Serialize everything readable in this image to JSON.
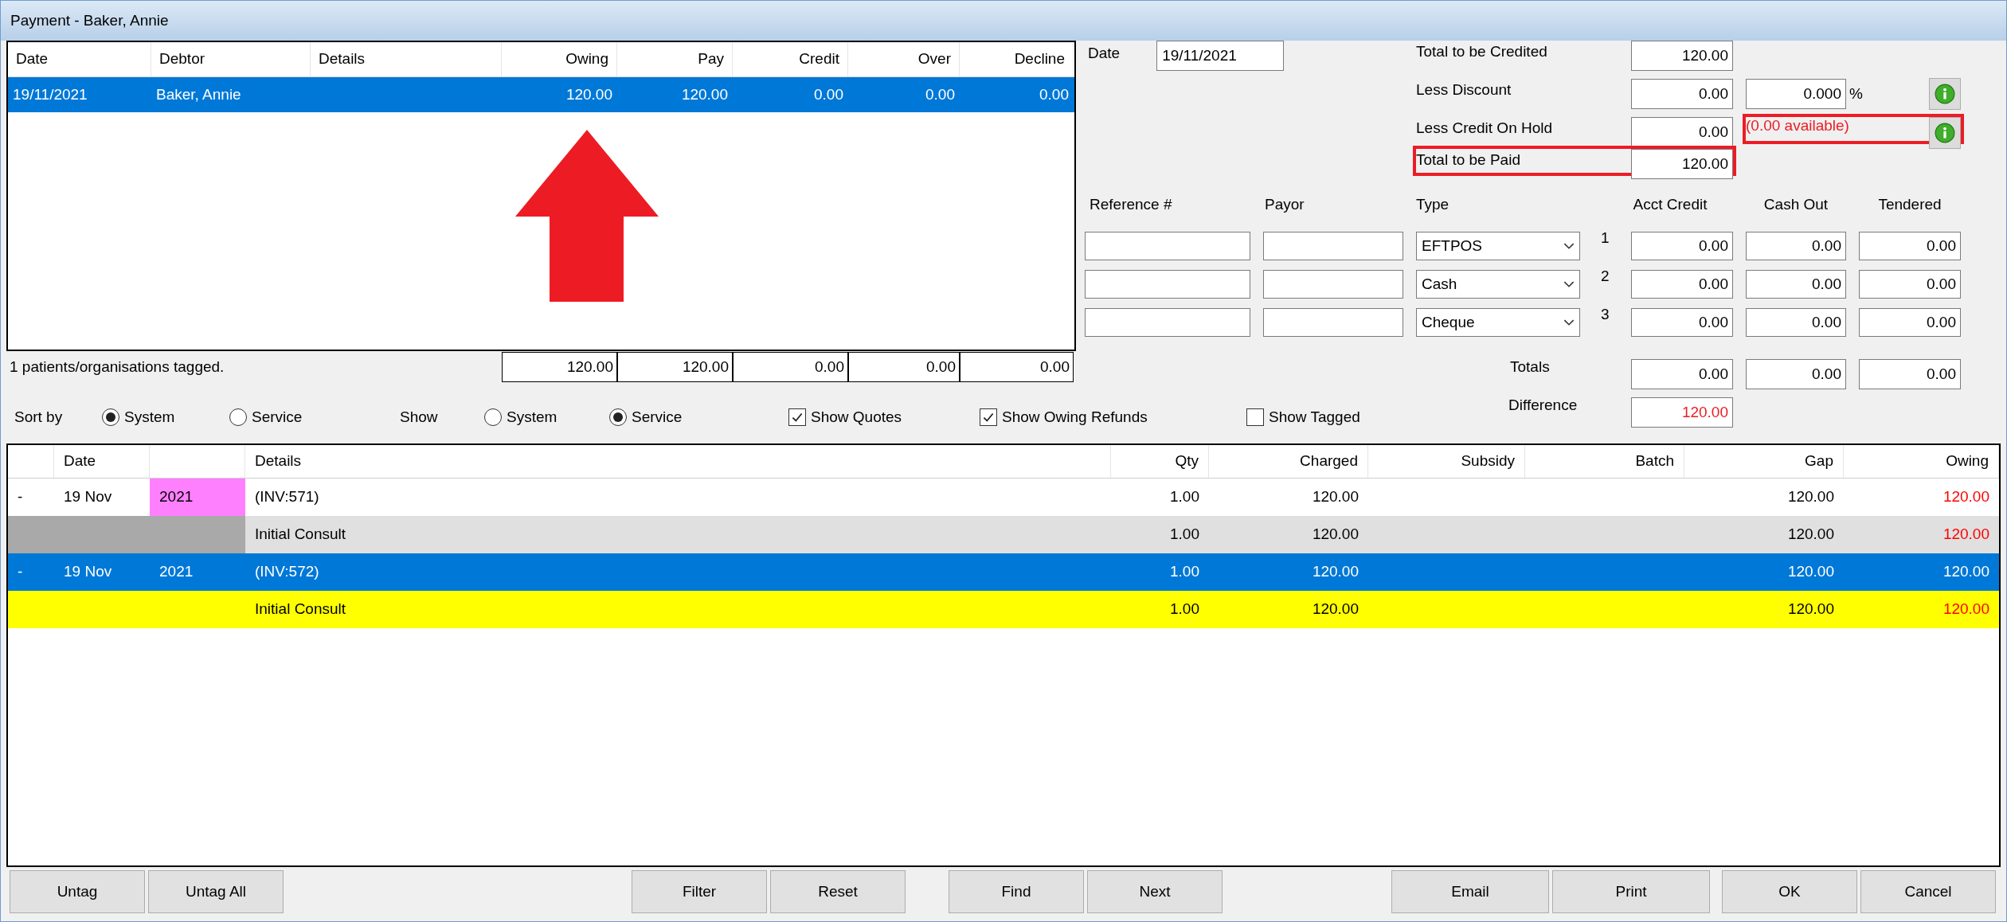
{
  "window": {
    "title": "Payment - Baker, Annie"
  },
  "debtor_table": {
    "columns": [
      "Date",
      "Debtor",
      "Details",
      "Owing",
      "Pay",
      "Credit",
      "Over",
      "Decline"
    ],
    "rows": [
      {
        "date": "19/11/2021",
        "debtor": "Baker, Annie",
        "owing": "120.00",
        "pay": "120.00",
        "credit": "0.00",
        "over": "0.00",
        "decline": "0.00",
        "selected": true
      }
    ],
    "status": "1 patients/organisations tagged.",
    "totals": [
      "120.00",
      "120.00",
      "0.00",
      "0.00",
      "0.00"
    ]
  },
  "payment": {
    "date_label": "Date",
    "date": "19/11/2021",
    "summary": [
      {
        "label": "Total to be Credited",
        "value": "120.00",
        "highlighted": false
      },
      {
        "label": "Less Discount",
        "value": "0.00",
        "percent": "0.000",
        "percent_sign": "%",
        "info_button": true,
        "highlighted": false
      },
      {
        "label": "Less Credit On Hold",
        "value": "0.00",
        "note": "(0.00 available)",
        "note_highlighted": true,
        "info_button": true,
        "highlighted": false
      },
      {
        "label": "Total to be Paid",
        "value": "120.00",
        "highlighted": true
      }
    ],
    "columns": [
      "Reference #",
      "Payor",
      "Type",
      "Acct Credit",
      "Cash Out",
      "Tendered"
    ],
    "lines": [
      {
        "type": "EFTPOS",
        "number": "1",
        "acct_credit": "0.00",
        "cash_out": "0.00",
        "tendered": "0.00"
      },
      {
        "type": "Cash",
        "number": "2",
        "acct_credit": "0.00",
        "cash_out": "0.00",
        "tendered": "0.00"
      },
      {
        "type": "Cheque",
        "number": "3",
        "acct_credit": "0.00",
        "cash_out": "0.00",
        "tendered": "0.00"
      }
    ],
    "totals_label": "Totals",
    "totals": [
      "0.00",
      "0.00",
      "0.00"
    ],
    "difference_label": "Difference",
    "difference": "120.00"
  },
  "filters": {
    "sort_label": "Sort by",
    "sort_options": [
      {
        "label": "System",
        "selected": true
      },
      {
        "label": "Service",
        "selected": false
      }
    ],
    "show_label": "Show",
    "show_options": [
      {
        "label": "System",
        "selected": false
      },
      {
        "label": "Service",
        "selected": true
      }
    ],
    "checkboxes": [
      {
        "label": "Show Quotes",
        "checked": true
      },
      {
        "label": "Show Owing Refunds",
        "checked": true
      },
      {
        "label": "Show Tagged",
        "checked": false
      }
    ]
  },
  "services_table": {
    "columns": [
      "Date",
      "Details",
      "Qty",
      "Charged",
      "Subsidy",
      "Batch",
      "Gap",
      "Owing"
    ],
    "rows": [
      {
        "kind": "invoice",
        "marker": "-",
        "date": "19 Nov",
        "year": "2021",
        "details": "(INV:571)",
        "qty": "1.00",
        "charged": "120.00",
        "gap": "120.00",
        "owing": "120.00",
        "selected": false,
        "color": "#ffffff",
        "tag": {
          "color": "#ff80ff"
        }
      },
      {
        "kind": "service",
        "details": "Initial Consult",
        "qty": "1.00",
        "charged": "120.00",
        "gap": "120.00",
        "owing": "120.00",
        "selected": false,
        "color": "#e0e0e0",
        "tag": {
          "color": "#a9a9a9"
        }
      },
      {
        "kind": "invoice",
        "marker": "-",
        "date": "19 Nov",
        "year": "2021",
        "details": "(INV:572)",
        "qty": "1.00",
        "charged": "120.00",
        "gap": "120.00",
        "owing": "120.00",
        "selected": true
      },
      {
        "kind": "service",
        "details": "Initial Consult",
        "qty": "1.00",
        "charged": "120.00",
        "gap": "120.00",
        "owing": "120.00",
        "selected": false,
        "color": "#ffff00"
      }
    ]
  },
  "button_groups": [
    [
      "Untag",
      "Untag All"
    ],
    [
      "Filter",
      "Reset"
    ],
    [
      "Find",
      "Next"
    ],
    [
      "Email",
      "Print"
    ],
    [
      "OK",
      "Cancel"
    ]
  ]
}
